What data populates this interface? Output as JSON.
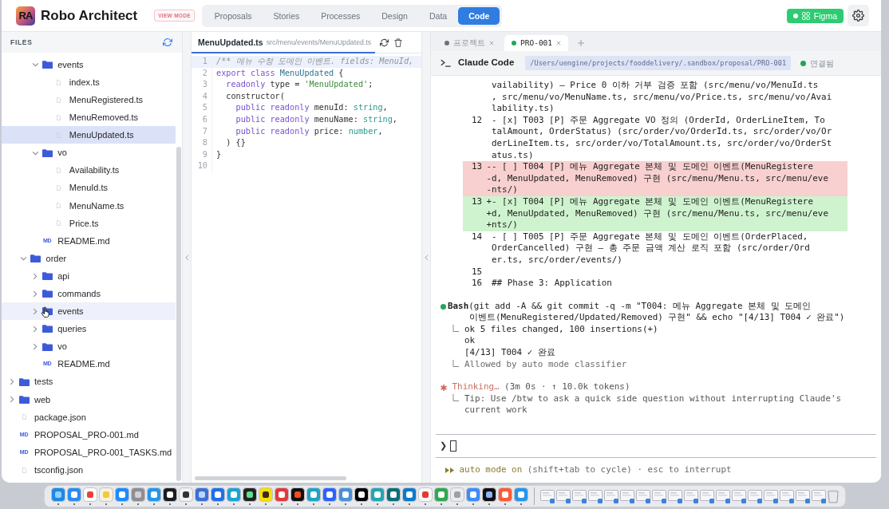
{
  "header": {
    "logo": "RA",
    "title": "Robo Architect",
    "mode_badge": "VIEW MODE",
    "nav": [
      {
        "label": "Proposals",
        "selected": false
      },
      {
        "label": "Stories",
        "selected": false
      },
      {
        "label": "Processes",
        "selected": false
      },
      {
        "label": "Design",
        "selected": false
      },
      {
        "label": "Data",
        "selected": false
      },
      {
        "label": "Code",
        "selected": true
      }
    ],
    "figma": {
      "label": "Figma",
      "connected": true
    }
  },
  "files": {
    "title": "FILES",
    "tree": [
      {
        "children": [
          {
            "children": [
              {
                "label": "events",
                "kind": "folder",
                "expanded": true,
                "selected": false,
                "hovered": false,
                "children": [
                  {
                    "label": "index.ts",
                    "kind": "file",
                    "selected": false,
                    "hovered": false
                  },
                  {
                    "label": "MenuRegistered.ts",
                    "kind": "file",
                    "selected": false,
                    "hovered": false
                  },
                  {
                    "label": "MenuRemoved.ts",
                    "kind": "file",
                    "selected": false,
                    "hovered": false
                  },
                  {
                    "label": "MenuUpdated.ts",
                    "kind": "file",
                    "selected": true,
                    "hovered": false
                  }
                ]
              },
              {
                "label": "vo",
                "kind": "folder",
                "expanded": true,
                "selected": false,
                "hovered": false,
                "children": [
                  {
                    "label": "Availability.ts",
                    "kind": "file",
                    "selected": false,
                    "hovered": false
                  },
                  {
                    "label": "MenuId.ts",
                    "kind": "file",
                    "selected": false,
                    "hovered": false
                  },
                  {
                    "label": "MenuName.ts",
                    "kind": "file",
                    "selected": false,
                    "hovered": false
                  },
                  {
                    "label": "Price.ts",
                    "kind": "file",
                    "selected": false,
                    "hovered": false
                  }
                ]
              },
              {
                "label": "README.md",
                "kind": "markdown",
                "badge": "MD",
                "selected": false,
                "hovered": false
              }
            ]
          },
          {
            "label": "order",
            "kind": "folder",
            "expanded": true,
            "selected": false,
            "hovered": false,
            "children": [
              {
                "label": "api",
                "kind": "folder",
                "expanded": false,
                "selected": false,
                "hovered": false
              },
              {
                "label": "commands",
                "kind": "folder",
                "expanded": false,
                "selected": false,
                "hovered": false
              },
              {
                "label": "events",
                "kind": "folder",
                "expanded": false,
                "selected": false,
                "hovered": true
              },
              {
                "label": "queries",
                "kind": "folder",
                "expanded": false,
                "selected": false,
                "hovered": false
              },
              {
                "label": "vo",
                "kind": "folder",
                "expanded": false,
                "selected": false,
                "hovered": false
              },
              {
                "label": "README.md",
                "kind": "markdown",
                "badge": "MD",
                "selected": false,
                "hovered": false
              }
            ]
          }
        ]
      },
      {
        "label": "tests",
        "kind": "folder",
        "expanded": false,
        "selected": false,
        "hovered": false
      },
      {
        "label": "web",
        "kind": "folder",
        "expanded": false,
        "selected": false,
        "hovered": false
      },
      {
        "label": "package.json",
        "kind": "file",
        "selected": false,
        "hovered": false
      },
      {
        "label": "PROPOSAL_PRO-001.md",
        "kind": "markdown",
        "badge": "MD",
        "selected": false,
        "hovered": false
      },
      {
        "label": "PROPOSAL_PRO-001_TASKS.md",
        "kind": "markdown",
        "badge": "MD",
        "selected": false,
        "hovered": false
      },
      {
        "label": "tsconfig.json",
        "kind": "file",
        "selected": false,
        "hovered": false
      }
    ]
  },
  "editor": {
    "tab": {
      "name": "MenuUpdated.ts",
      "path": "src/menu/events/MenuUpdated.ts",
      "selected": true
    },
    "lines": [
      {
        "number": "1",
        "current": true,
        "tokens": [
          {
            "kind": "comment",
            "text": "/** 메뉴 수정 도메인 이벤트. fields: MenuId,"
          }
        ]
      },
      {
        "number": "2",
        "current": false,
        "tokens": [
          {
            "kind": "keyword",
            "text": "export class"
          },
          {
            "kind": "class",
            "text": " MenuUpdated"
          },
          {
            "kind": "plain",
            "text": " {"
          }
        ]
      },
      {
        "number": "3",
        "current": false,
        "tokens": [
          {
            "kind": "keyword",
            "text": "  readonly"
          },
          {
            "kind": "plain",
            "text": " type = "
          },
          {
            "kind": "string",
            "text": "'MenuUpdated'"
          },
          {
            "kind": "plain",
            "text": ";"
          }
        ]
      },
      {
        "number": "4",
        "current": false,
        "tokens": [
          {
            "kind": "plain",
            "text": "  constructor("
          }
        ]
      },
      {
        "number": "5",
        "current": false,
        "tokens": [
          {
            "kind": "keyword",
            "text": "    public readonly"
          },
          {
            "kind": "plain",
            "text": " menuId: "
          },
          {
            "kind": "type",
            "text": "string"
          },
          {
            "kind": "plain",
            "text": ","
          }
        ]
      },
      {
        "number": "6",
        "current": false,
        "tokens": [
          {
            "kind": "keyword",
            "text": "    public readonly"
          },
          {
            "kind": "plain",
            "text": " menuName: "
          },
          {
            "kind": "type",
            "text": "string"
          },
          {
            "kind": "plain",
            "text": ","
          }
        ]
      },
      {
        "number": "7",
        "current": false,
        "tokens": [
          {
            "kind": "keyword",
            "text": "    public readonly"
          },
          {
            "kind": "plain",
            "text": " price: "
          },
          {
            "kind": "type",
            "text": "number"
          },
          {
            "kind": "plain",
            "text": ","
          }
        ]
      },
      {
        "number": "8",
        "current": false,
        "tokens": [
          {
            "kind": "plain",
            "text": "  ) {}"
          }
        ]
      },
      {
        "number": "9",
        "current": false,
        "tokens": [
          {
            "kind": "plain",
            "text": "}"
          }
        ]
      },
      {
        "number": "10",
        "current": false
      }
    ]
  },
  "terminal": {
    "tabs": [
      {
        "label": "프로젝트",
        "selected": false,
        "color": "#6b7280"
      },
      {
        "label": "PRO-001",
        "selected": true,
        "color": "#22a55a"
      }
    ],
    "header": {
      "title": "Claude Code",
      "path": "/Users/uengine/projects/fooddelivery/.sandbox/proposal/PRO-001",
      "status": "연결됨",
      "connected": true
    },
    "diff": [
      {
        "kind": "context",
        "lines": [
          "vailability) — Price 0 이하 거부 검증 포함 (src/menu/vo/MenuId.ts",
          ", src/menu/vo/MenuName.ts, src/menu/vo/Price.ts, src/menu/vo/Avai",
          "lability.ts)"
        ]
      },
      {
        "kind": "context",
        "number": "12",
        "lines": [
          "- [x] T003 [P] 주문 Aggregate VO 정의 (OrderId, OrderLineItem, To",
          "talAmount, OrderStatus) (src/order/vo/OrderId.ts, src/order/vo/Or",
          "derLineItem.ts, src/order/vo/TotalAmount.ts, src/order/vo/OrderSt",
          "atus.ts)"
        ]
      },
      {
        "kind": "removed",
        "number": "13",
        "lines": [
          "-- [ ] T004 [P] 메뉴 Aggregate 본체 및 도메인 이벤트(MenuRegistere",
          "-d, MenuUpdated, MenuRemoved) 구현 (src/menu/Menu.ts, src/menu/eve",
          "-nts/)"
        ]
      },
      {
        "kind": "added",
        "number": "13",
        "lines": [
          "+- [x] T004 [P] 메뉴 Aggregate 본체 및 도메인 이벤트(MenuRegistere",
          "+d, MenuUpdated, MenuRemoved) 구현 (src/menu/Menu.ts, src/menu/eve",
          "+nts/)"
        ]
      },
      {
        "kind": "context",
        "number": "14",
        "lines": [
          "- [ ] T005 [P] 주문 Aggregate 본체 및 도메인 이벤트(OrderPlaced,",
          "OrderCancelled) 구현 — 총 주문 금액 계산 로직 포함 (src/order/Ord",
          "er.ts, src/order/events/)"
        ]
      },
      {
        "kind": "context",
        "number": "15"
      },
      {
        "kind": "context",
        "number": "16",
        "lines": [
          "## Phase 3: Application"
        ]
      }
    ],
    "tool_call": {
      "name": "Bash",
      "command_lines": [
        "(git add -A && git commit -q -m \"T004: 메뉴 Aggregate 본체 및 도메인",
        "이벤트(MenuRegistered/Updated/Removed) 구현\" && echo \"[4/13] T004 ✓ 완료\")"
      ],
      "output_lines": [
        "ok 5 files changed, 100 insertions(+)",
        "ok",
        "[4/13] T004 ✓ 완료"
      ],
      "note": "Allowed by auto mode classifier"
    },
    "thinking": {
      "label": "Thinking…",
      "stats": "(3m 0s · ↑ 10.0k tokens)",
      "tip": "Tip: Use /btw to ask a quick side question without interrupting Claude's current work"
    },
    "prompt": {
      "symbol": "❯"
    },
    "status_line": {
      "mode": "auto mode on",
      "hint": "(shift+tab to cycle) · esc to interrupt"
    }
  }
}
